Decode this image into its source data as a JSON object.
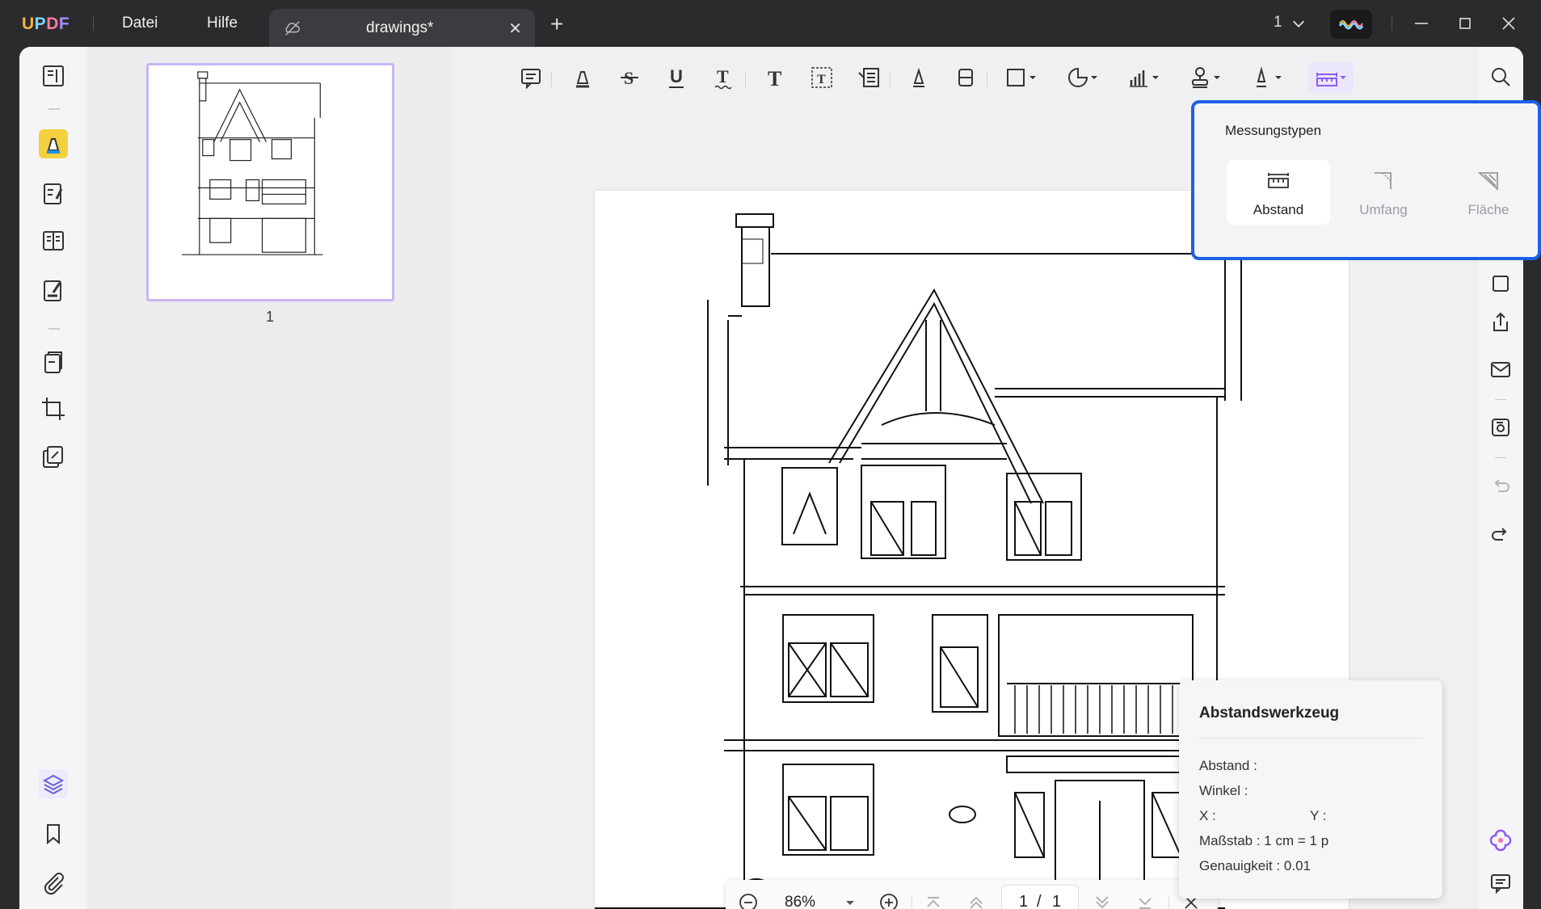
{
  "app": {
    "logo": "UPDF",
    "menu": [
      "Datei",
      "Hilfe"
    ],
    "tab_title": "drawings*",
    "page_indicator": "1"
  },
  "thumbnail": {
    "page_number": "1"
  },
  "measure_popup": {
    "heading": "Messungstypen",
    "types": [
      {
        "label": "Abstand",
        "selected": true
      },
      {
        "label": "Umfang",
        "selected": false
      },
      {
        "label": "Fläche",
        "selected": false
      }
    ]
  },
  "distance_panel": {
    "title": "Abstandswerkzeug",
    "abstand_label": "Abstand :",
    "winkel_label": "Winkel :",
    "x_label": "X :",
    "y_label": "Y :",
    "scale_label": "Maßstab : 1 cm = 1 p",
    "precision_label": "Genauigkeit : 0.01"
  },
  "zoom_bar": {
    "zoom": "86%",
    "current_page": "1",
    "separator": "/",
    "total_pages": "1"
  },
  "colors": {
    "accent": "#1d5fe6",
    "highlight": "#f4d03f",
    "selected_tool": "#a78bfa"
  }
}
